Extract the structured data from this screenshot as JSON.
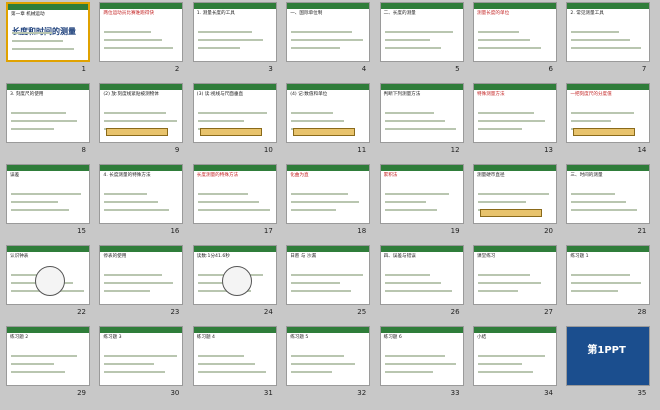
{
  "slides": [
    {
      "n": "1",
      "text": "第一章 机械运动",
      "sub": "长度和时间的测量"
    },
    {
      "n": "2",
      "text": "两位运动员比赛谁跑得快"
    },
    {
      "n": "3",
      "text": "1. 测量长度的工具"
    },
    {
      "n": "4",
      "text": "一、国际单位制"
    },
    {
      "n": "5",
      "text": "二、长度的测量"
    },
    {
      "n": "6",
      "text": "测量长度的单位"
    },
    {
      "n": "7",
      "text": "2. 常见测量工具"
    },
    {
      "n": "8",
      "text": "3. 刻度尺的使用"
    },
    {
      "n": "9",
      "text": "(2) 放:刻度线紧贴被测物体"
    },
    {
      "n": "10",
      "text": "(3) 读:视线与尺面垂直"
    },
    {
      "n": "11",
      "text": "(4) 记:数值和单位"
    },
    {
      "n": "12",
      "text": "判断下列测量方法"
    },
    {
      "n": "13",
      "text": "特殊测量方法"
    },
    {
      "n": "14",
      "text": "一把刻度尺的分度值"
    },
    {
      "n": "15",
      "text": "误差"
    },
    {
      "n": "16",
      "text": "4. 长度测量的特殊方法"
    },
    {
      "n": "17",
      "text": "长度测量的特殊方法"
    },
    {
      "n": "18",
      "text": "化曲为直"
    },
    {
      "n": "19",
      "text": "累积法"
    },
    {
      "n": "20",
      "text": "测量硬币直径"
    },
    {
      "n": "21",
      "text": "三、时间的测量"
    },
    {
      "n": "22",
      "text": "认识钟表"
    },
    {
      "n": "23",
      "text": "停表的使用"
    },
    {
      "n": "24",
      "text": "读数:1分41.6秒"
    },
    {
      "n": "25",
      "text": "日晷 与 沙漏"
    },
    {
      "n": "26",
      "text": "四、误差与错误"
    },
    {
      "n": "27",
      "text": "课堂练习"
    },
    {
      "n": "28",
      "text": "练习题 1"
    },
    {
      "n": "29",
      "text": "练习题 2"
    },
    {
      "n": "30",
      "text": "练习题 3"
    },
    {
      "n": "31",
      "text": "练习题 4"
    },
    {
      "n": "32",
      "text": "练习题 5"
    },
    {
      "n": "33",
      "text": "练习题 6"
    },
    {
      "n": "34",
      "text": "小结"
    },
    {
      "n": "35",
      "text": "第1PPT"
    }
  ]
}
